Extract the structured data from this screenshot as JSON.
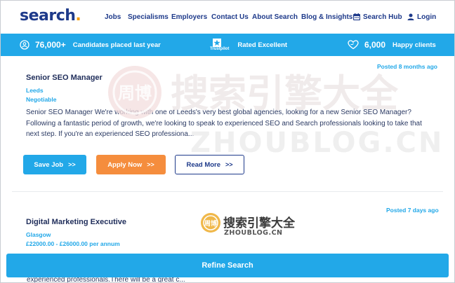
{
  "header": {
    "logo_text": "search",
    "logo_dot": ".",
    "nav": {
      "jobs": "Jobs",
      "specialisms": "Specialisms",
      "employers": "Employers",
      "contact": "Contact Us",
      "about": "About Search",
      "blog": "Blog & Insights",
      "hub": "Search Hub",
      "login": "Login"
    }
  },
  "stats": {
    "candidates_count": "76,000+",
    "candidates_label": "Candidates placed last year",
    "trustpilot_brand": "Trustpilot",
    "rating_label": "Rated Excellent",
    "clients_count": "6,000",
    "clients_label": "Happy clients"
  },
  "jobs": [
    {
      "posted": "Posted 8 months ago",
      "title": "Senior SEO Manager",
      "location": "Leeds",
      "salary": "Negotiable",
      "description": "Senior SEO Manager We're working with one of Leeds's very best global agencies, looking for a new Senior SEO Manager? Following a fantastic period of growth, we're looking to speak to experienced SEO and Search professionals looking to take that next step. If you're an experienced SEO professiona...",
      "save_label": "Save Job",
      "apply_label": "Apply Now",
      "read_label": "Read More",
      "arrow": ">>"
    },
    {
      "posted": "Posted 7 days ago",
      "title": "Digital Marketing Executive",
      "location": "Glasgow",
      "salary": "£22000.00 - £26000.00 per annum",
      "description_peek": "experienced professionals.There will be a great c..."
    }
  ],
  "refine_label": "Refine Search",
  "watermark": {
    "text_cn": "搜索引擎大全",
    "text_en": "ZHOUBLOG.CN"
  },
  "colors": {
    "brand_navy": "#1e3a8a",
    "accent_blue": "#22a8e8",
    "accent_orange": "#f58d3d",
    "logo_dot": "#f59e0b"
  }
}
